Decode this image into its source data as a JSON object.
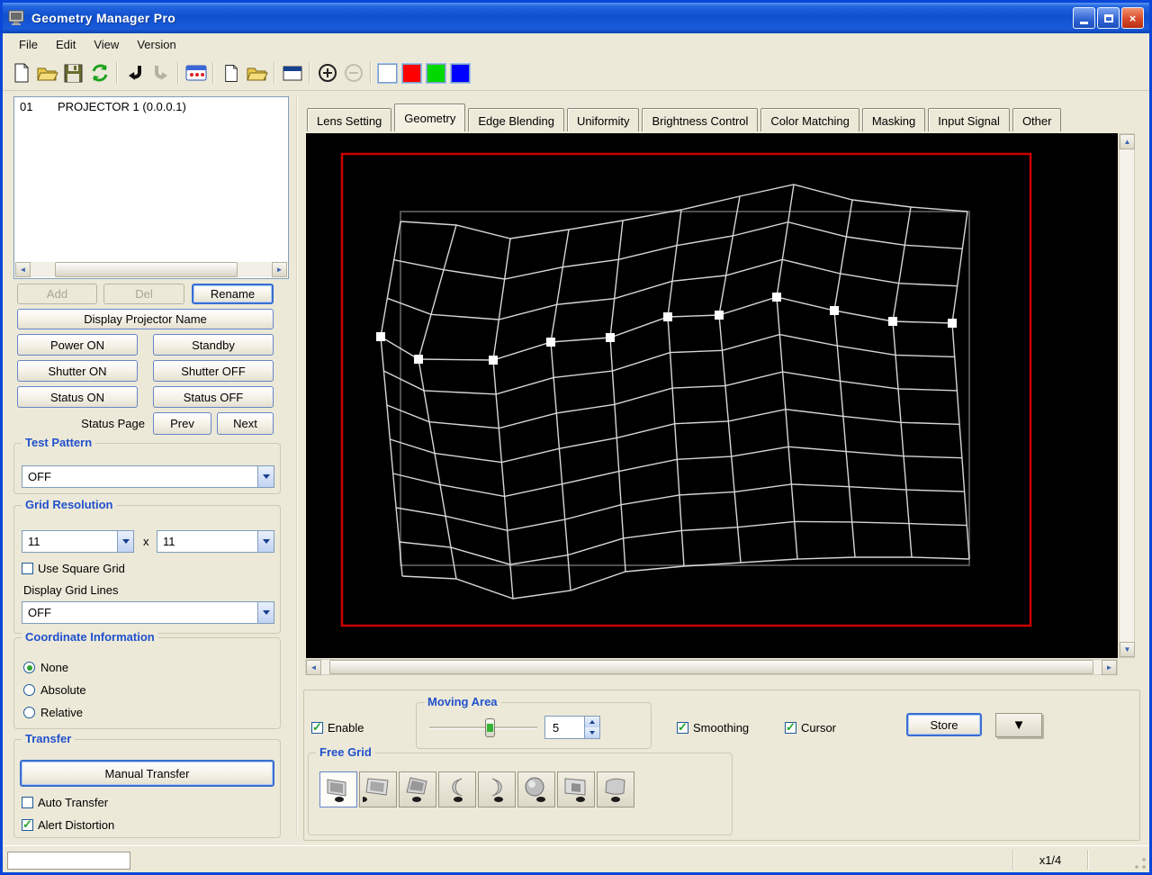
{
  "window": {
    "title": "Geometry Manager Pro",
    "controls": {
      "minimize": "minimize",
      "maximize": "maximize",
      "close": "close"
    }
  },
  "menu": {
    "items": [
      "File",
      "Edit",
      "View",
      "Version"
    ]
  },
  "toolbar": {
    "icons": [
      "new-file-icon",
      "open-file-icon",
      "save-icon",
      "refresh-icon",
      "undo-icon",
      "redo-icon",
      "display-id-icon",
      "new-config-icon",
      "open-config-icon",
      "window-mode-icon",
      "zoom-in-icon",
      "zoom-out-icon"
    ],
    "swatches": [
      "#ffffff",
      "#ff0000",
      "#00d800",
      "#0000ff"
    ]
  },
  "projector_list": {
    "items": [
      {
        "num": "01",
        "name": "PROJECTOR 1 (0.0.0.1)"
      }
    ]
  },
  "left_panel": {
    "add": "Add",
    "del": "Del",
    "rename": "Rename",
    "display_projector_name": "Display Projector Name",
    "power_on": "Power ON",
    "standby": "Standby",
    "shutter_on": "Shutter ON",
    "shutter_off": "Shutter OFF",
    "status_on": "Status ON",
    "status_off": "Status OFF",
    "status_page": "Status Page",
    "prev": "Prev",
    "next": "Next",
    "test_pattern": {
      "label": "Test Pattern",
      "value": "OFF"
    },
    "grid_resolution": {
      "label": "Grid Resolution",
      "h_value": "11",
      "times": "x",
      "v_value": "11",
      "use_square_grid": "Use Square Grid",
      "display_grid_lines": "Display Grid Lines",
      "display_grid_lines_value": "OFF"
    },
    "coordinate_information": {
      "label": "Coordinate Information",
      "options": [
        "None",
        "Absolute",
        "Relative"
      ],
      "selected": "None"
    },
    "transfer": {
      "label": "Transfer",
      "manual": "Manual Transfer",
      "auto": "Auto Transfer",
      "alert": "Alert Distortion",
      "auto_checked": false,
      "alert_checked": true
    }
  },
  "tabs": {
    "items": [
      "Lens Setting",
      "Geometry",
      "Edge Blending",
      "Uniformity",
      "Brightness Control",
      "Color Matching",
      "Masking",
      "Input Signal",
      "Other"
    ],
    "active_index": 1
  },
  "canvas": {
    "background": "#000000",
    "border_color": "#cc0000",
    "reference_color": "#4f4f4f",
    "line_color": "#d6d6d6",
    "handle_color": "#ffffff",
    "red_rect": [
      40,
      23,
      765,
      524
    ],
    "reference_rect": [
      105,
      87,
      632,
      393
    ],
    "mesh": {
      "rows": 11,
      "cols": 11,
      "handle_row": 3,
      "columns": [
        {
          "t": [
            105,
            98
          ],
          "m": [
            83,
            226
          ],
          "b": [
            107,
            492
          ]
        },
        {
          "t": [
            167,
            102
          ],
          "m": [
            125,
            251
          ],
          "b": [
            167,
            495
          ]
        },
        {
          "t": [
            227,
            117
          ],
          "m": [
            208,
            252
          ],
          "b": [
            230,
            517
          ]
        },
        {
          "t": [
            292,
            107
          ],
          "m": [
            272,
            232
          ],
          "b": [
            294,
            508
          ]
        },
        {
          "t": [
            352,
            97
          ],
          "m": [
            338,
            227
          ],
          "b": [
            355,
            487
          ]
        },
        {
          "t": [
            417,
            85
          ],
          "m": [
            402,
            204
          ],
          "b": [
            420,
            481
          ]
        },
        {
          "t": [
            482,
            70
          ],
          "m": [
            459,
            202
          ],
          "b": [
            483,
            477
          ]
        },
        {
          "t": [
            542,
            57
          ],
          "m": [
            523,
            182
          ],
          "b": [
            546,
            473
          ]
        },
        {
          "t": [
            607,
            74
          ],
          "m": [
            587,
            197
          ],
          "b": [
            610,
            471
          ]
        },
        {
          "t": [
            672,
            82
          ],
          "m": [
            652,
            209
          ],
          "b": [
            673,
            471
          ]
        },
        {
          "t": [
            735,
            87
          ],
          "m": [
            718,
            211
          ],
          "b": [
            737,
            473
          ]
        }
      ]
    }
  },
  "bottom_panel": {
    "enable": "Enable",
    "enable_checked": true,
    "moving_area": {
      "label": "Moving Area",
      "value": "5"
    },
    "smoothing": "Smoothing",
    "smoothing_checked": true,
    "cursor": "Cursor",
    "cursor_checked": true,
    "store": "Store",
    "free_grid": {
      "label": "Free Grid",
      "icons": [
        "free-grid-screen-flat-icon",
        "free-grid-screen-tilt-icon",
        "free-grid-screen-lean-icon",
        "free-grid-cylinder-concave-icon",
        "free-grid-cylinder-convex-icon",
        "free-grid-sphere-icon",
        "free-grid-screen-angled-icon",
        "free-grid-screen-curved-icon"
      ],
      "selected_index": 0
    }
  },
  "status_bar": {
    "zoom_label": "x1/4"
  }
}
